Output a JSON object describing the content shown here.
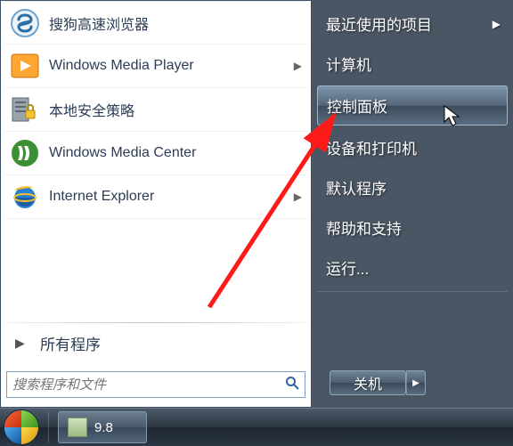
{
  "programs": [
    {
      "label": "搜狗高速浏览器",
      "icon": "sogou"
    },
    {
      "label": "Windows Media Player",
      "icon": "wmp",
      "hasArrow": true
    },
    {
      "label": "本地安全策略",
      "icon": "secpol"
    },
    {
      "label": "Windows Media Center",
      "icon": "wmc"
    },
    {
      "label": "Internet Explorer",
      "icon": "ie",
      "hasArrow": true
    }
  ],
  "all_programs_label": "所有程序",
  "search_placeholder": "搜索程序和文件",
  "right_items": [
    {
      "label": "最近使用的项目",
      "hasArrow": true
    },
    {
      "label": "计算机"
    },
    {
      "label": "控制面板",
      "highlight": true
    },
    {
      "label": "设备和打印机"
    },
    {
      "label": "默认程序"
    },
    {
      "label": "帮助和支持"
    },
    {
      "label": "运行..."
    }
  ],
  "shutdown_label": "关机",
  "taskbar_item_label": "9.8"
}
